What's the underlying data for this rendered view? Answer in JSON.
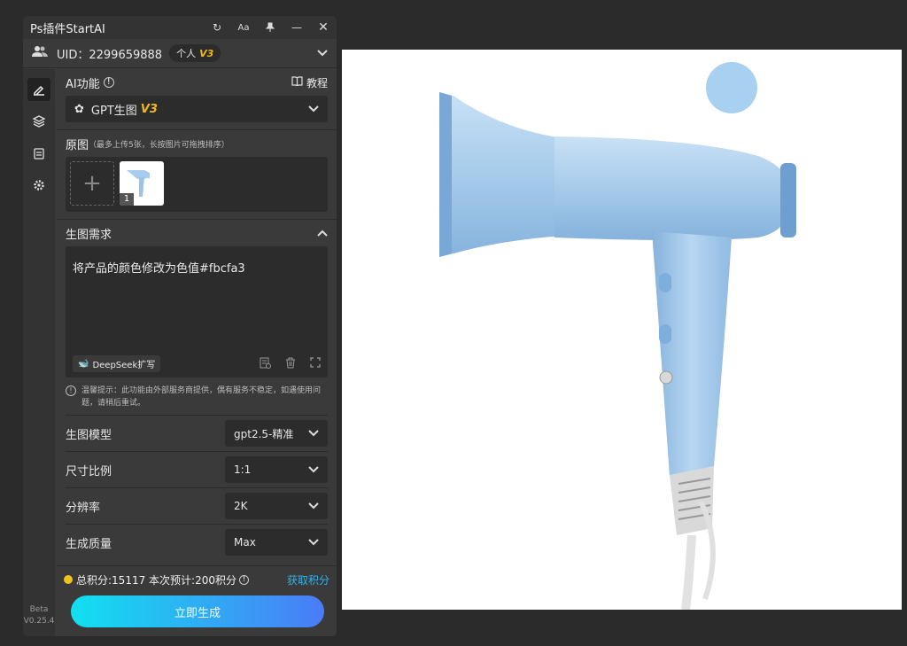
{
  "panel": {
    "title": "Ps插件StartAI",
    "uid": "UID：2299659888",
    "plan": "个人",
    "plan_version": "V3"
  },
  "ai": {
    "label": "AI功能",
    "tutorial": "教程",
    "selected": "GPT生图",
    "selected_version": "V3"
  },
  "source": {
    "label": "原图",
    "hint": "（最多上传5张，长按图片可拖拽排序）",
    "thumb_index": "1"
  },
  "prompt": {
    "label": "生图需求",
    "text": "将产品的颜色修改为色值#fbcfa3",
    "deepseek": "DeepSeek扩写"
  },
  "notice": "温馨提示：此功能由外部服务商提供，偶有服务不稳定，如遇使用问题，请稍后重试。",
  "settings": [
    {
      "label": "生图模型",
      "value": "gpt2.5-精准"
    },
    {
      "label": "尺寸比例",
      "value": "1:1"
    },
    {
      "label": "分辨率",
      "value": "2K"
    },
    {
      "label": "生成质量",
      "value": "Max"
    }
  ],
  "footer": {
    "points": "总积分:15117  本次预计:200积分",
    "get_points": "获取积分",
    "generate": "立即生成"
  },
  "version": {
    "beta": "Beta",
    "number": "V0.25.4"
  },
  "colors": {
    "accent": "#2bb5f2",
    "badge": "#f0b91c",
    "product": "#a8cdec"
  }
}
